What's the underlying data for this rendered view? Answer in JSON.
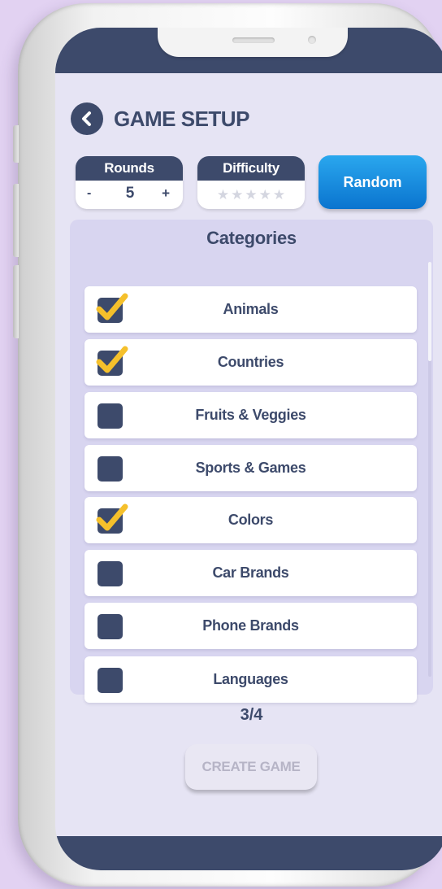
{
  "header": {
    "title": "GAME SETUP"
  },
  "rounds": {
    "label": "Rounds",
    "minus": "-",
    "value": "5",
    "plus": "+"
  },
  "difficulty": {
    "label": "Difficulty",
    "stars_total": 5,
    "stars_filled": 0
  },
  "random_button": {
    "label": "Random"
  },
  "categories": {
    "title": "Categories",
    "items": [
      {
        "label": "Animals",
        "checked": true
      },
      {
        "label": "Countries",
        "checked": true
      },
      {
        "label": "Fruits & Veggies",
        "checked": false
      },
      {
        "label": "Sports & Games",
        "checked": false
      },
      {
        "label": "Colors",
        "checked": true
      },
      {
        "label": "Car Brands",
        "checked": false
      },
      {
        "label": "Phone Brands",
        "checked": false
      },
      {
        "label": "Languages",
        "checked": false
      }
    ]
  },
  "selection_count": "3/4",
  "create_button": {
    "label": "CREATE GAME",
    "enabled": false
  },
  "colors": {
    "primary": "#3d4a6b",
    "accent_blue": "#0a74cf",
    "check_yellow": "#f5c02b",
    "panel": "#d8d5f0"
  },
  "icons": {
    "back": "chevron-left-icon",
    "check": "check-icon",
    "star": "star-icon"
  }
}
